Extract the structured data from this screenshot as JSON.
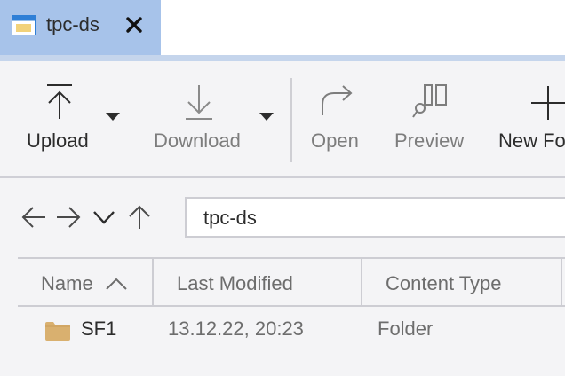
{
  "tab": {
    "title": "tpc-ds",
    "icon": "window-icon",
    "close_icon": "close-icon"
  },
  "toolbar": {
    "upload_label": "Upload",
    "download_label": "Download",
    "open_label": "Open",
    "preview_label": "Preview",
    "new_folder_label": "New Fo"
  },
  "navigation": {
    "back_icon": "arrow-left-icon",
    "forward_icon": "arrow-right-icon",
    "history_icon": "chevron-down-icon",
    "up_icon": "arrow-up-icon",
    "path": "tpc-ds"
  },
  "table": {
    "columns": [
      "Name",
      "Last Modified",
      "Content Type"
    ],
    "sort_column": "Name",
    "sort_direction": "ascending",
    "rows": [
      {
        "name": "SF1",
        "last_modified": "13.12.22, 20:23",
        "content_type": "Folder",
        "icon": "folder-icon"
      }
    ]
  },
  "colors": {
    "active_tab": "#a7c3ea",
    "tab_underline": "#c5d5ec",
    "folder": "#d9b06f",
    "background": "#f4f4f6"
  }
}
